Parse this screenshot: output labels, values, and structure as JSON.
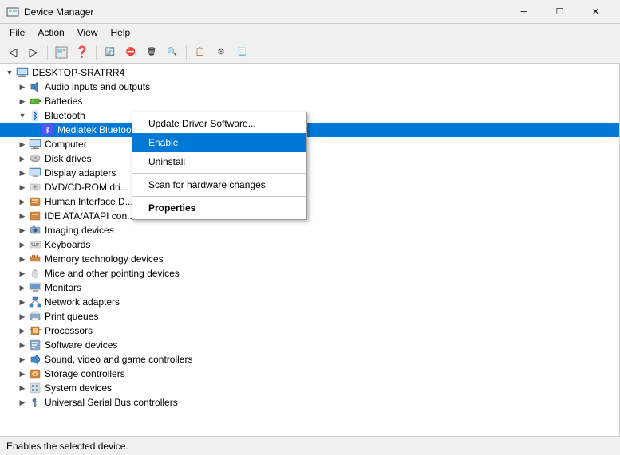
{
  "window": {
    "title": "Device Manager",
    "minimize_label": "─",
    "restore_label": "☐",
    "close_label": "✕"
  },
  "menubar": {
    "items": [
      "File",
      "Action",
      "View",
      "Help"
    ]
  },
  "toolbar": {
    "buttons": [
      "←",
      "→",
      "🖥",
      "❓",
      "📋",
      "🔌",
      "🔍",
      "🖨",
      "⚙",
      "🔧"
    ]
  },
  "tree": {
    "root": {
      "label": "DESKTOP-SRATRR4",
      "expanded": true
    },
    "items": [
      {
        "id": "audio",
        "label": "Audio inputs and outputs",
        "level": 1,
        "expanded": false,
        "icon": "audio"
      },
      {
        "id": "batteries",
        "label": "Batteries",
        "level": 1,
        "expanded": false,
        "icon": "battery"
      },
      {
        "id": "bluetooth",
        "label": "Bluetooth",
        "level": 1,
        "expanded": true,
        "icon": "bluetooth"
      },
      {
        "id": "bt-device",
        "label": "Mediatek Bluetooth Adaptor",
        "level": 2,
        "expanded": false,
        "icon": "bt-adapter",
        "selected": true
      },
      {
        "id": "computer",
        "label": "Computer",
        "level": 1,
        "expanded": false,
        "icon": "computer"
      },
      {
        "id": "disk",
        "label": "Disk drives",
        "level": 1,
        "expanded": false,
        "icon": "disk"
      },
      {
        "id": "display",
        "label": "Display adapters",
        "level": 1,
        "expanded": false,
        "icon": "display"
      },
      {
        "id": "dvd",
        "label": "DVD/CD-ROM dri...",
        "level": 1,
        "expanded": false,
        "icon": "dvd"
      },
      {
        "id": "hid",
        "label": "Human Interface D...",
        "level": 1,
        "expanded": false,
        "icon": "hid"
      },
      {
        "id": "ide",
        "label": "IDE ATA/ATAPI con...",
        "level": 1,
        "expanded": false,
        "icon": "ide"
      },
      {
        "id": "imaging",
        "label": "Imaging devices",
        "level": 1,
        "expanded": false,
        "icon": "imaging"
      },
      {
        "id": "keyboards",
        "label": "Keyboards",
        "level": 1,
        "expanded": false,
        "icon": "keyboard"
      },
      {
        "id": "memory",
        "label": "Memory technology devices",
        "level": 1,
        "expanded": false,
        "icon": "memory"
      },
      {
        "id": "mice",
        "label": "Mice and other pointing devices",
        "level": 1,
        "expanded": false,
        "icon": "mouse"
      },
      {
        "id": "monitors",
        "label": "Monitors",
        "level": 1,
        "expanded": false,
        "icon": "monitor"
      },
      {
        "id": "network",
        "label": "Network adapters",
        "level": 1,
        "expanded": false,
        "icon": "network"
      },
      {
        "id": "print-queues",
        "label": "Print queues",
        "level": 1,
        "expanded": false,
        "icon": "print"
      },
      {
        "id": "processors",
        "label": "Processors",
        "level": 1,
        "expanded": false,
        "icon": "processor"
      },
      {
        "id": "software",
        "label": "Software devices",
        "level": 1,
        "expanded": false,
        "icon": "software"
      },
      {
        "id": "sound",
        "label": "Sound, video and game controllers",
        "level": 1,
        "expanded": false,
        "icon": "sound"
      },
      {
        "id": "storage",
        "label": "Storage controllers",
        "level": 1,
        "expanded": false,
        "icon": "storage"
      },
      {
        "id": "system",
        "label": "System devices",
        "level": 1,
        "expanded": false,
        "icon": "system"
      },
      {
        "id": "usb",
        "label": "Universal Serial Bus controllers",
        "level": 1,
        "expanded": false,
        "icon": "usb"
      }
    ]
  },
  "context_menu": {
    "items": [
      {
        "id": "update-driver",
        "label": "Update Driver Software...",
        "bold": false,
        "highlighted": false
      },
      {
        "id": "enable",
        "label": "Enable",
        "bold": false,
        "highlighted": true
      },
      {
        "id": "uninstall",
        "label": "Uninstall",
        "bold": false,
        "highlighted": false
      },
      {
        "id": "scan",
        "label": "Scan for hardware changes",
        "bold": false,
        "highlighted": false
      },
      {
        "id": "properties",
        "label": "Properties",
        "bold": true,
        "highlighted": false
      }
    ]
  },
  "status_bar": {
    "text": "Enables the selected device."
  }
}
